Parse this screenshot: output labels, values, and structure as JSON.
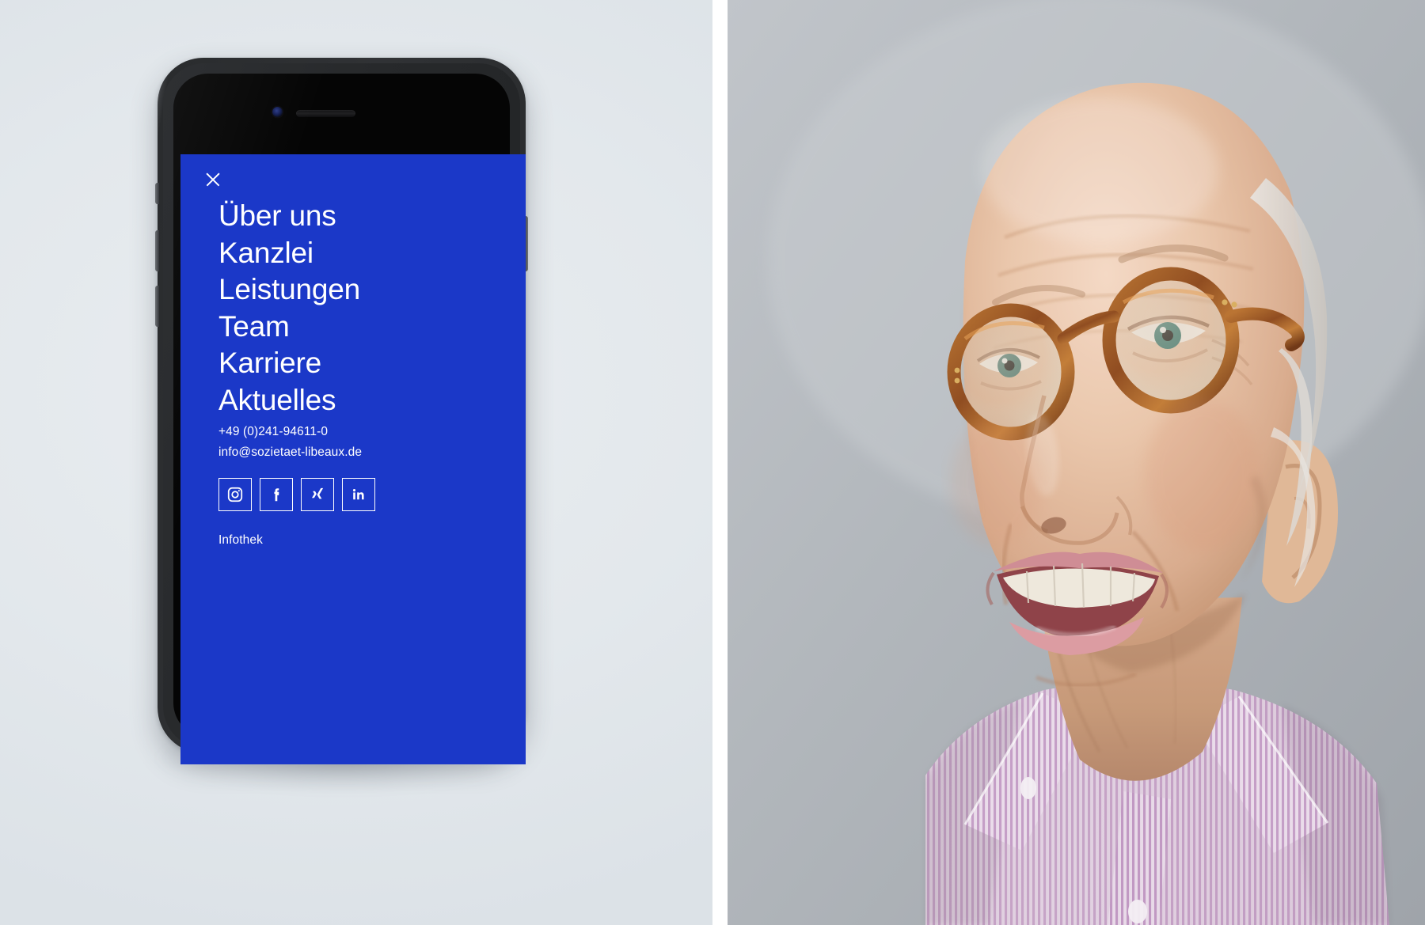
{
  "page": {
    "title": "Sozietaet Libeaux – Mobile Menu Mockup",
    "layout": "two-panel: phone mockup left, portrait photograph right"
  },
  "colors": {
    "menu_background": "#1b38c8",
    "menu_text": "#ffffff",
    "left_panel_background": "#e3e8ec",
    "panel_divider": "#ffffff",
    "photo_background": "#b2b7bc",
    "phone_body": "#303235"
  },
  "phone_mockup": {
    "device": "smartphone-with-home-button",
    "hardware": {
      "front_camera": "front-camera",
      "ear_speaker": "ear-speaker",
      "home_button": "home-button",
      "mute_switch": "mute-switch",
      "volume_up": "volume-up-button",
      "volume_down": "volume-down-button",
      "power": "power-button"
    },
    "screen": {
      "close_button": {
        "icon": "close-x-icon",
        "label": "Schließen"
      },
      "nav_items": [
        {
          "label": "Über uns"
        },
        {
          "label": "Kanzlei"
        },
        {
          "label": "Leistungen"
        },
        {
          "label": "Team"
        },
        {
          "label": "Karriere"
        },
        {
          "label": "Aktuelles"
        }
      ],
      "contact": {
        "phone": "+49 (0)241-94611-0",
        "email": "info@sozietaet-libeaux.de"
      },
      "social_links": [
        {
          "name": "instagram",
          "icon": "instagram-icon",
          "label": "Instagram"
        },
        {
          "name": "facebook",
          "icon": "facebook-icon",
          "label": "Facebook"
        },
        {
          "name": "xing",
          "icon": "xing-icon",
          "label": "XING"
        },
        {
          "name": "linkedin",
          "icon": "linkedin-icon",
          "label": "LinkedIn"
        }
      ],
      "footer_link": {
        "label": "Infothek"
      }
    }
  },
  "photo": {
    "alt": "Portrait of an elderly smiling bald man wearing round tortoiseshell glasses and a pink striped shirt, looking up and to the left",
    "subject": {
      "glasses": "round tortoiseshell frames",
      "expression": "smiling, mouth open showing teeth",
      "hair": "bald with short white hair at sides",
      "shirt": "pink and white vertically striped dress shirt, open collar, white buttons"
    }
  }
}
